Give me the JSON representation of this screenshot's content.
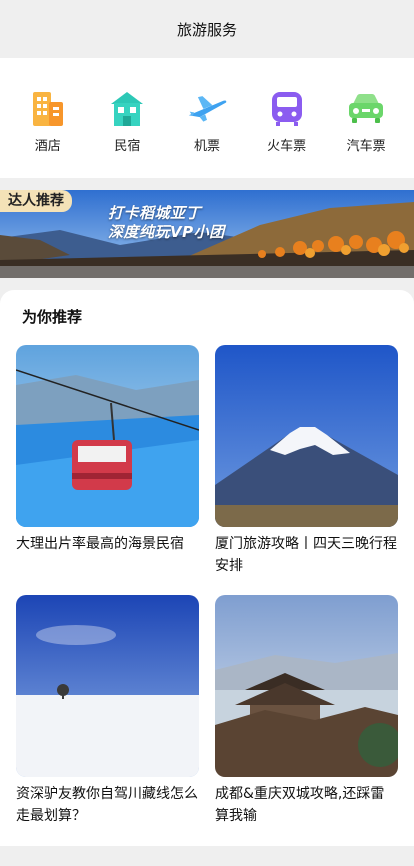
{
  "header": {
    "title": "旅游服务"
  },
  "nav": [
    {
      "label": "酒店",
      "icon": "hotel-icon",
      "color": "#f7a334"
    },
    {
      "label": "民宿",
      "icon": "homestay-icon",
      "color": "#2ec9b8"
    },
    {
      "label": "机票",
      "icon": "airplane-icon",
      "color": "#3ea2f0"
    },
    {
      "label": "火车票",
      "icon": "train-icon",
      "color": "#8b5cf0"
    },
    {
      "label": "汽车票",
      "icon": "car-icon",
      "color": "#6bd66a"
    }
  ],
  "banner": {
    "tag": "达人推荐",
    "line1": "打卡稻城亚丁",
    "line2": "深度纯玩VP小团"
  },
  "recommend": {
    "title": "为你推荐",
    "items": [
      {
        "caption": "大理出片率最高的海景民宿"
      },
      {
        "caption": "厦门旅游攻略丨四天三晚行程安排"
      },
      {
        "caption": "资深驴友教你自驾川藏线怎么走最划算？"
      },
      {
        "caption": "成都&重庆双城攻略,还踩雷算我输"
      }
    ]
  }
}
